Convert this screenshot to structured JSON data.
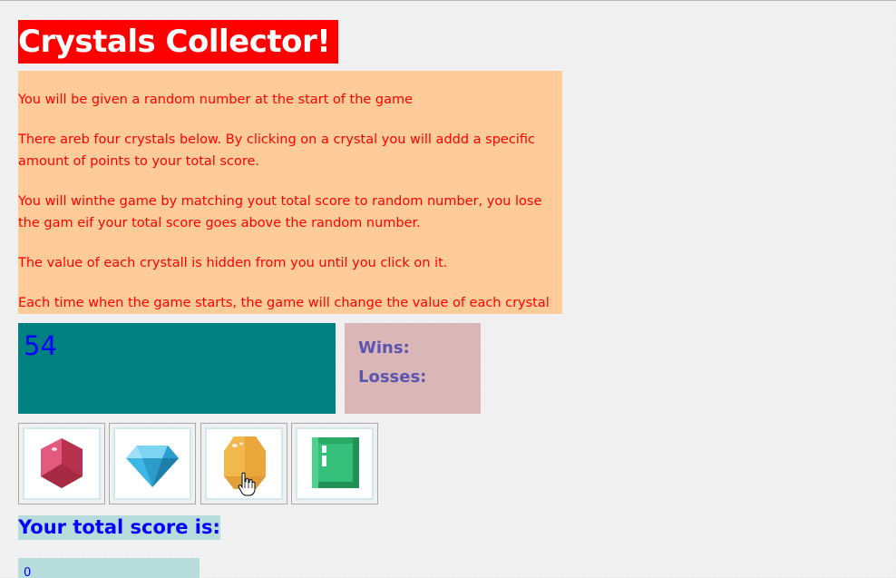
{
  "title": "Crystals Collector!",
  "instructions": [
    "You will be given a random number at the start of the game",
    "There areb four crystals below. By clicking on a crystal you will addd a specific amount of points to your total score.",
    "You will winthe game by matching yout total score to random number, you lose the gam eif your total score goes above the random number.",
    "The value of each crystall is hidden from you until you click on it.",
    "Each time when the game starts, the game will change the value of each crystal"
  ],
  "random_number": "54",
  "stats": {
    "wins_label": "Wins:",
    "losses_label": "Losses:"
  },
  "crystals": [
    {
      "icon": "red-crystal-icon",
      "color": "#d94469"
    },
    {
      "icon": "blue-diamond-icon",
      "color": "#3db7e4"
    },
    {
      "icon": "yellow-crystal-icon",
      "color": "#f2b84b"
    },
    {
      "icon": "green-crystal-icon",
      "color": "#35c17b"
    }
  ],
  "score": {
    "label": "Your total score is:",
    "value": "0"
  },
  "colors": {
    "title_bg": "#ff0000",
    "instructions_bg": "#ffcc99",
    "instructions_text": "#ff0000",
    "random_bg": "#008080",
    "stats_bg": "#dab6b6",
    "score_bg": "#b6dcdc",
    "accent_text": "#0000ff"
  }
}
